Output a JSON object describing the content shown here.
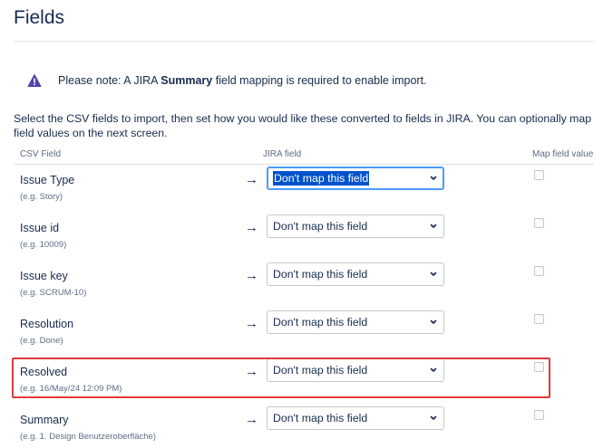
{
  "page": {
    "title": "Fields"
  },
  "notice": {
    "prefix": "Please note: A JIRA ",
    "bold": "Summary",
    "suffix": " field mapping is required to enable import.",
    "icon": "warning-icon",
    "icon_color": "#5243aa"
  },
  "intro": "Select the CSV fields to import, then set how you would like these converted to fields in JIRA. You can optionally map field values on the next screen.",
  "columns": {
    "csv_field": "CSV Field",
    "jira_field": "JIRA field",
    "map_value": "Map field value"
  },
  "rows": [
    {
      "name": "Issue Type",
      "example": "(e.g. Story)",
      "mapping": "Don't map this field",
      "focused": true,
      "map_value_checked": false
    },
    {
      "name": "Issue id",
      "example": "(e.g. 10009)",
      "mapping": "Don't map this field",
      "focused": false,
      "map_value_checked": false
    },
    {
      "name": "Issue key",
      "example": "(e.g. SCRUM-10)",
      "mapping": "Don't map this field",
      "focused": false,
      "map_value_checked": false
    },
    {
      "name": "Resolution",
      "example": "(e.g. Done)",
      "mapping": "Don't map this field",
      "focused": false,
      "map_value_checked": false
    },
    {
      "name": "Resolved",
      "example": "(e.g. 16/May/24 12:09 PM)",
      "mapping": "Don't map this field",
      "focused": false,
      "map_value_checked": false,
      "highlighted": true
    },
    {
      "name": "Summary",
      "example": "(e.g. 1. Design Benutzeroberfläche)",
      "mapping": "Don't map this field",
      "focused": false,
      "map_value_checked": false
    }
  ],
  "arrow_glyph": "→",
  "colors": {
    "highlight_border": "#e03a3a",
    "selection": "#0052cc",
    "focus_border": "#4c9aff"
  }
}
